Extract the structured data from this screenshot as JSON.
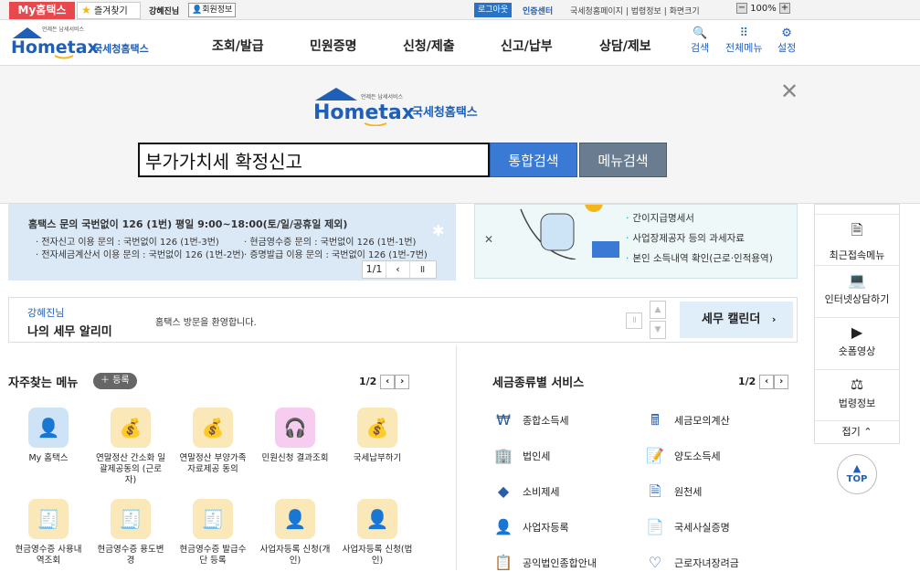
{
  "topbar": {
    "my_hometax": "My홈택스",
    "favorites": "즐겨찾기",
    "user_name": "강혜진님",
    "member_info": "회원정보",
    "logout": "로그아웃",
    "cert_center": "인증센터",
    "links": "국세청홈페이지 | 법령정보 | 화면크기",
    "zoom": "100%"
  },
  "header": {
    "logo_text": "Hometax",
    "logo_sub": "국세청홈택스",
    "logo_tag": "언제든 납세서비스",
    "nav": [
      "조회/발급",
      "민원증명",
      "신청/제출",
      "신고/납부",
      "상담/제보"
    ],
    "icons": [
      {
        "label": "검색",
        "icon": "search-icon"
      },
      {
        "label": "전체메뉴",
        "icon": "grid-icon"
      },
      {
        "label": "설정",
        "icon": "gear-icon"
      }
    ]
  },
  "overlay": {
    "search_value": "부가가치세 확정신고",
    "btn_integrated": "통합검색",
    "btn_menu": "메뉴검색"
  },
  "banner": {
    "main_line": "홈택스 문의 국번없이 126 (1번) 평일 9:00~18:00(토/일/공휴일 제외)",
    "lines": [
      "· 전자신고 이용 문의 : 국번없이 126 (1번-3번)",
      "· 현금영수증 문의 : 국번없이 126 (1번-1번)",
      "· 전자세금계산서 이용 문의 : 국번없이 126 (1번-2번)",
      "· 증명발급 이용 문의 : 국번없이 126 (1번-7번)"
    ],
    "pager": "1/1"
  },
  "right_banner": {
    "items": [
      "간이지급명세서",
      "사업장제공자 등의 과세자료",
      "본인 소득내역 확인(근로·인적용역)"
    ]
  },
  "alarm": {
    "user": "강혜진님",
    "title": "나의 세무 알리미",
    "message": "홈택스 방문을 환영합니다.",
    "calendar": "세무 캘린더"
  },
  "frequent_menu": {
    "title": "자주찾는 메뉴",
    "register": "등록",
    "pager": "1/2",
    "items": [
      "My 홈택스",
      "연말정산 간소화 일괄제공동의 (근로자)",
      "연말정산 부양가족 자료제공 동의",
      "민원신청 결과조회",
      "국세납부하기",
      "현금영수증 사용내역조회",
      "현금영수증 용도변경",
      "현금영수증 발급수단 등록",
      "사업자등록 신청(개인)",
      "사업자등록 신청(법인)"
    ]
  },
  "tax_service": {
    "title": "세금종류별 서비스",
    "pager": "1/2",
    "items": [
      "종합소득세",
      "세금모의계산",
      "법인세",
      "양도소득세",
      "소비제세",
      "원천세",
      "사업자등록",
      "국세사실증명",
      "공익법인종합안내",
      "근로자녀장려금"
    ]
  },
  "quick": {
    "items": [
      "최근접속메뉴",
      "인터넷상담하기",
      "숏폼영상",
      "법령정보"
    ],
    "fold": "접기",
    "top": "TOP"
  }
}
